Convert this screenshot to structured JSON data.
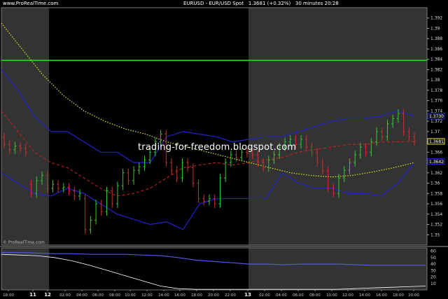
{
  "header": {
    "site": "www.ProRealTime.com",
    "instrument": "EURUSD - EUR/USD Spot",
    "price": "1.3681",
    "change": "(+0.32%)",
    "timeframe": "30 minutes",
    "time": "20:28"
  },
  "watermark": "trading-for-freedom.blogspot.com",
  "credit": "© ProRealTime.com",
  "colors": {
    "background": "#000000",
    "session_shade": "#333333",
    "up_candle": "#33cc33",
    "down_candle": "#cc3333",
    "bollinger": "#2222cc",
    "middle_band": "#cc2222",
    "moving_average": "#e8e820",
    "level_line": "#11dd11"
  },
  "chart_data": [
    {
      "type": "line",
      "title": "EURUSD - EUR/USD Spot",
      "ylim": [
        1.348,
        1.394
      ],
      "y_ticks": [
        "1.392",
        "1.39",
        "1.388",
        "1.386",
        "1.384",
        "1.382",
        "1.38",
        "1.378",
        "1.376",
        "1.374",
        "1.372",
        "1.37",
        "1.368",
        "1.366",
        "1.364",
        "1.362",
        "1.36",
        "1.358",
        "1.356",
        "1.354",
        "1.352",
        "1.35"
      ],
      "x_ticks": [
        "18:00",
        "11",
        "12",
        "02:00",
        "04:00",
        "06:00",
        "08:00",
        "10:00",
        "12:00",
        "14:00",
        "16:00",
        "18:00",
        "20:00",
        "22:00",
        "13",
        "02:00",
        "04:00",
        "06:00",
        "08:00",
        "10:00",
        "12:00",
        "14:00",
        "16:00",
        "18:00",
        "20:00"
      ],
      "price_tags": [
        {
          "label": "1.3730",
          "value": 1.373,
          "color": "#2222cc"
        },
        {
          "label": "1.3681",
          "value": 1.3681,
          "color": "#e8e820"
        },
        {
          "label": "1.3642",
          "value": 1.3642,
          "color": "#2222cc"
        }
      ],
      "horizontal_level": 1.3838,
      "candles": [
        {
          "o": 1.369,
          "c": 1.3675
        },
        {
          "o": 1.3675,
          "c": 1.3665
        },
        {
          "o": 1.3665,
          "c": 1.3672
        },
        {
          "o": 1.3672,
          "c": 1.3668
        },
        {
          "o": 1.3668,
          "c": 1.366
        },
        {
          "o": 1.3598,
          "c": 1.358
        },
        {
          "o": 1.358,
          "c": 1.3605
        },
        {
          "o": 1.3605,
          "c": 1.3615
        },
        {
          "o": 1.3615,
          "c": 1.359
        },
        {
          "o": 1.359,
          "c": 1.3598
        },
        {
          "o": 1.3598,
          "c": 1.359
        },
        {
          "o": 1.359,
          "c": 1.3592
        },
        {
          "o": 1.3592,
          "c": 1.3585
        },
        {
          "o": 1.3585,
          "c": 1.3575
        },
        {
          "o": 1.3575,
          "c": 1.358
        },
        {
          "o": 1.357,
          "c": 1.351
        },
        {
          "o": 1.351,
          "c": 1.3528
        },
        {
          "o": 1.3528,
          "c": 1.356
        },
        {
          "o": 1.356,
          "c": 1.3545
        },
        {
          "o": 1.3545,
          "c": 1.3585
        },
        {
          "o": 1.3585,
          "c": 1.356
        },
        {
          "o": 1.356,
          "c": 1.3595
        },
        {
          "o": 1.3595,
          "c": 1.362
        },
        {
          "o": 1.362,
          "c": 1.3605
        },
        {
          "o": 1.3605,
          "c": 1.3625
        },
        {
          "o": 1.3625,
          "c": 1.3632
        },
        {
          "o": 1.3632,
          "c": 1.3645
        },
        {
          "o": 1.3645,
          "c": 1.366
        },
        {
          "o": 1.366,
          "c": 1.368
        },
        {
          "o": 1.368,
          "c": 1.3695
        },
        {
          "o": 1.3695,
          "c": 1.364
        },
        {
          "o": 1.364,
          "c": 1.3625
        },
        {
          "o": 1.3625,
          "c": 1.361
        },
        {
          "o": 1.361,
          "c": 1.364
        },
        {
          "o": 1.364,
          "c": 1.363
        },
        {
          "o": 1.363,
          "c": 1.36
        },
        {
          "o": 1.36,
          "c": 1.357
        },
        {
          "o": 1.357,
          "c": 1.3565
        },
        {
          "o": 1.3565,
          "c": 1.357
        },
        {
          "o": 1.357,
          "c": 1.356
        },
        {
          "o": 1.356,
          "c": 1.361
        },
        {
          "o": 1.361,
          "c": 1.364
        },
        {
          "o": 1.364,
          "c": 1.3655
        },
        {
          "o": 1.3655,
          "c": 1.365
        },
        {
          "o": 1.365,
          "c": 1.366
        },
        {
          "o": 1.366,
          "c": 1.3658
        },
        {
          "o": 1.3658,
          "c": 1.3655
        },
        {
          "o": 1.3655,
          "c": 1.364
        },
        {
          "o": 1.364,
          "c": 1.363
        },
        {
          "o": 1.363,
          "c": 1.3645
        },
        {
          "o": 1.3645,
          "c": 1.3655
        },
        {
          "o": 1.3655,
          "c": 1.367
        },
        {
          "o": 1.367,
          "c": 1.368
        },
        {
          "o": 1.368,
          "c": 1.3685
        },
        {
          "o": 1.3685,
          "c": 1.3675
        },
        {
          "o": 1.3675,
          "c": 1.3685
        },
        {
          "o": 1.3685,
          "c": 1.367
        },
        {
          "o": 1.367,
          "c": 1.366
        },
        {
          "o": 1.366,
          "c": 1.364
        },
        {
          "o": 1.364,
          "c": 1.3625
        },
        {
          "o": 1.3625,
          "c": 1.359
        },
        {
          "o": 1.359,
          "c": 1.358
        },
        {
          "o": 1.358,
          "c": 1.361
        },
        {
          "o": 1.361,
          "c": 1.3625
        },
        {
          "o": 1.3625,
          "c": 1.364
        },
        {
          "o": 1.364,
          "c": 1.3655
        },
        {
          "o": 1.3655,
          "c": 1.367
        },
        {
          "o": 1.367,
          "c": 1.366
        },
        {
          "o": 1.366,
          "c": 1.368
        },
        {
          "o": 1.368,
          "c": 1.37
        },
        {
          "o": 1.37,
          "c": 1.369
        },
        {
          "o": 1.369,
          "c": 1.3715
        },
        {
          "o": 1.3715,
          "c": 1.3725
        },
        {
          "o": 1.3725,
          "c": 1.3735
        },
        {
          "o": 1.3735,
          "c": 1.37
        },
        {
          "o": 1.37,
          "c": 1.369
        },
        {
          "o": 1.369,
          "c": 1.3681
        }
      ],
      "upper_band": [
        1.382,
        1.378,
        1.373,
        1.37,
        1.37,
        1.368,
        1.366,
        1.366,
        1.364,
        1.364,
        1.369,
        1.37,
        1.3695,
        1.369,
        1.368,
        1.3685,
        1.369,
        1.369,
        1.37,
        1.371,
        1.372,
        1.3725,
        1.3725,
        1.373,
        1.374,
        1.373
      ],
      "lower_band": [
        1.362,
        1.36,
        1.358,
        1.3575,
        1.359,
        1.358,
        1.356,
        1.354,
        1.353,
        1.352,
        1.3525,
        1.351,
        1.356,
        1.357,
        1.357,
        1.357,
        1.357,
        1.362,
        1.36,
        1.359,
        1.359,
        1.358,
        1.358,
        1.3575,
        1.36,
        1.364
      ],
      "middle_band": [
        1.374,
        1.37,
        1.366,
        1.364,
        1.363,
        1.361,
        1.359,
        1.3575,
        1.358,
        1.359,
        1.361,
        1.363,
        1.3635,
        1.364,
        1.3635,
        1.364,
        1.3645,
        1.365,
        1.366,
        1.3665,
        1.367,
        1.3675,
        1.3675,
        1.368,
        1.368,
        1.3681
      ],
      "moving_average": [
        1.391,
        1.386,
        1.381,
        1.377,
        1.374,
        1.372,
        1.3705,
        1.3695,
        1.368,
        1.367,
        1.366,
        1.365,
        1.364,
        1.363,
        1.362,
        1.3615,
        1.3612,
        1.3615,
        1.3622,
        1.363,
        1.364
      ]
    },
    {
      "type": "line",
      "title": "",
      "ylim": [
        0,
        65
      ],
      "y_ticks": [
        "60",
        "50",
        "40",
        "30",
        "20",
        "10"
      ],
      "series": [
        {
          "color": "#5555dd",
          "values": [
            58,
            58,
            57,
            56,
            56,
            55,
            55,
            55,
            54,
            53,
            50,
            46,
            44,
            42,
            40,
            40,
            39,
            40,
            40,
            40,
            39,
            38,
            38,
            38,
            38
          ]
        },
        {
          "color": "#ffffff",
          "values": [
            55,
            54,
            53,
            50,
            45,
            38,
            30,
            22,
            14,
            6,
            2,
            1,
            1,
            1,
            1,
            1,
            1,
            1,
            1,
            1,
            2,
            3,
            4,
            5,
            6
          ]
        }
      ]
    }
  ]
}
